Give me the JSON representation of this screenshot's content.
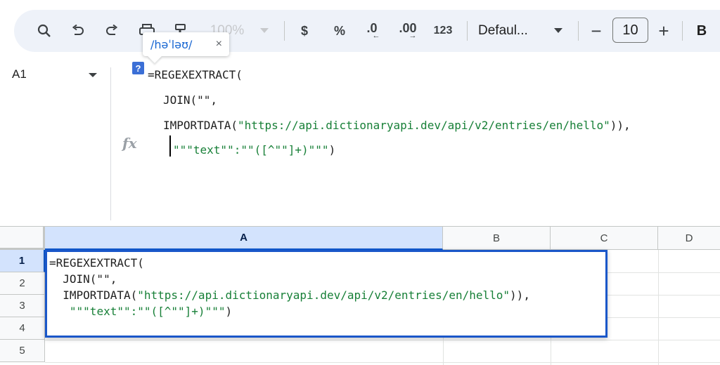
{
  "toolbar": {
    "zoom": "100%",
    "currency": "$",
    "percent": "%",
    "decrease_decimal": ".0",
    "increase_decimal": ".00",
    "number_format": "123",
    "font_name": "Defaul...",
    "font_size": "10",
    "minus": "−",
    "plus": "+",
    "bold": "B"
  },
  "tooltip": {
    "pronunciation": "/həˈləʊ/",
    "close": "×"
  },
  "name_box": {
    "value": "A1"
  },
  "formula_bar": {
    "help": "?",
    "fx": "fx",
    "line1": "=REGEXEXTRACT(",
    "line2": "JOIN(\"\",",
    "line3_pre": "IMPORTDATA(",
    "line3_str": "\"https://api.dictionaryapi.dev/api/v2/entries/en/hello\"",
    "line3_post": ")),",
    "line4_str": "\"\"\"text\"\":\"\"([^\"\"]+)\"\"\"",
    "line4_post": ")"
  },
  "grid": {
    "columns": [
      "A",
      "B",
      "C",
      "D"
    ],
    "rows": [
      "1",
      "2",
      "3",
      "4",
      "5"
    ],
    "selected_column": "A",
    "selected_row": "1"
  },
  "cell_editor": {
    "line1": "=REGEXEXTRACT(",
    "line2": "  JOIN(\"\",",
    "line3_pre": "  IMPORTDATA(",
    "line3_str": "\"https://api.dictionaryapi.dev/api/v2/entries/en/hello\"",
    "line3_post": ")),",
    "line4_pad": "   ",
    "line4_str": "\"\"\"text\"\":\"\"([^\"\"]+)\"\"\"",
    "line4_post": ")"
  },
  "colors": {
    "accent": "#0b57d0",
    "string": "#188038",
    "toolbar_bg": "#eef2f9"
  }
}
